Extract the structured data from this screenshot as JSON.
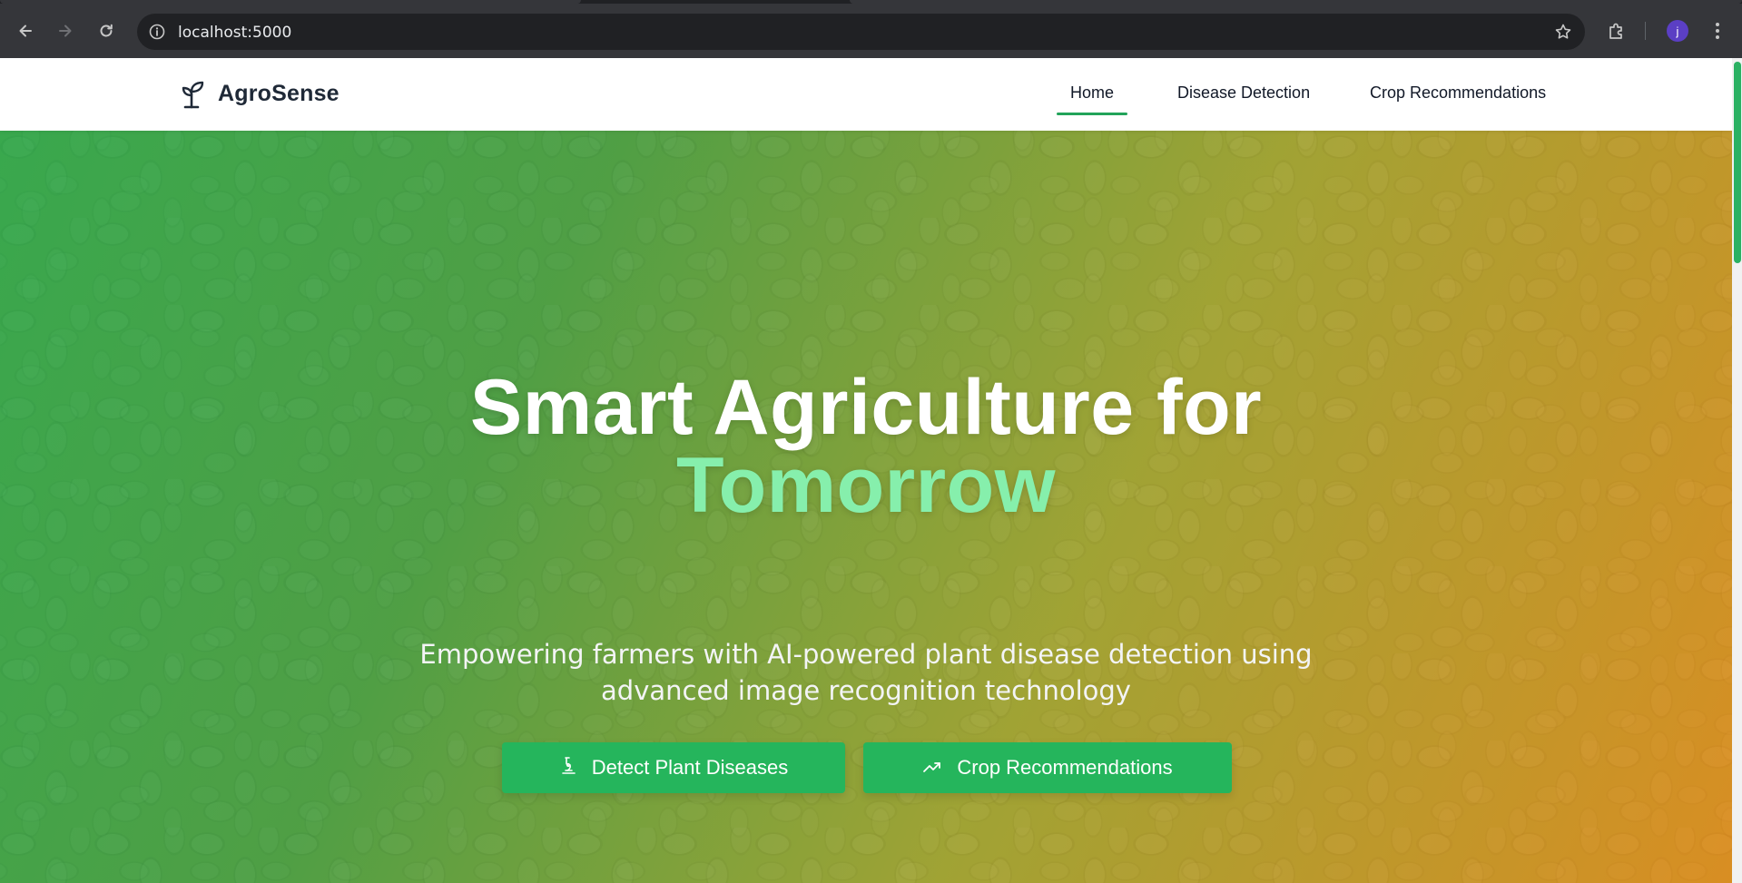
{
  "browser": {
    "url": "localhost:5000",
    "profile_initial": "j"
  },
  "site": {
    "brand": "AgroSense",
    "nav": [
      {
        "label": "Home",
        "active": true
      },
      {
        "label": "Disease Detection",
        "active": false
      },
      {
        "label": "Crop Recommendations",
        "active": false
      }
    ]
  },
  "hero": {
    "title_line1": "Smart Agriculture for",
    "title_line2": "Tomorrow",
    "subtitle": "Empowering farmers with AI-powered plant disease detection using advanced image recognition technology",
    "buttons": [
      {
        "label": "Detect Plant Diseases",
        "icon": "microscope-icon"
      },
      {
        "label": "Crop Recommendations",
        "icon": "trending-up-icon"
      }
    ]
  },
  "colors": {
    "accent_green": "#25b55c",
    "highlight_green": "#86efac",
    "gradient_start": "#2eaa50",
    "gradient_end": "#e88c1e"
  }
}
